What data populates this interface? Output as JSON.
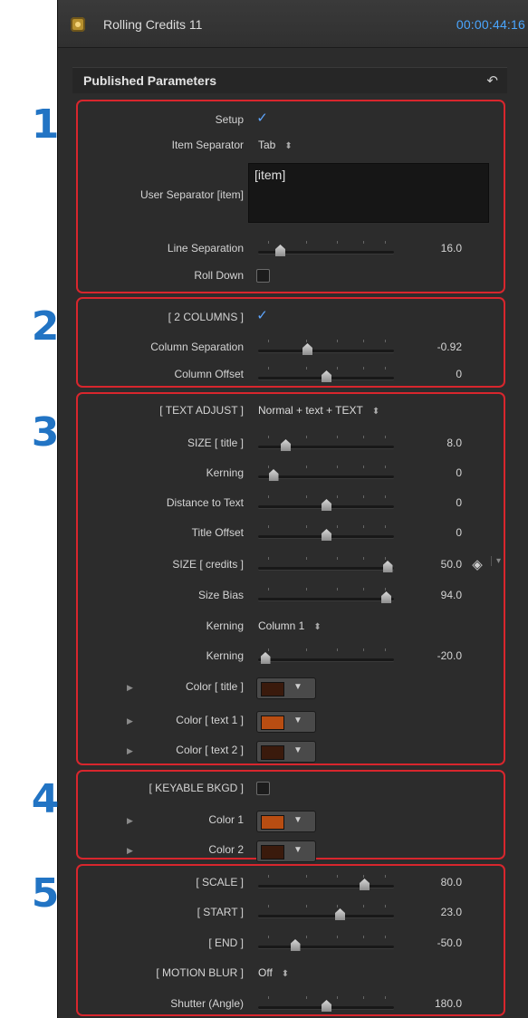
{
  "window": {
    "title": "Rolling Credits 11",
    "timecode": "00:00:44:16"
  },
  "panel": {
    "title": "Published Parameters"
  },
  "groups": [
    {
      "number": "1",
      "rows": [
        {
          "kind": "checkbox",
          "label": "Setup",
          "checked": true
        },
        {
          "kind": "popup",
          "label": "Item Separator",
          "value": "Tab"
        },
        {
          "kind": "textarea",
          "label": "User Separator [item]",
          "value": "[item]"
        },
        {
          "kind": "slider",
          "label": "Line Separation",
          "value": "16.0",
          "level": 0.16
        },
        {
          "kind": "checkbox",
          "label": "Roll Down",
          "checked": false
        }
      ]
    },
    {
      "number": "2",
      "rows": [
        {
          "kind": "checkbox",
          "label": "[  2  COLUMNS  ]",
          "checked": true
        },
        {
          "kind": "slider",
          "label": "Column Separation",
          "value": "-0.92",
          "level": 0.36
        },
        {
          "kind": "slider",
          "label": "Column Offset",
          "value": "0",
          "level": 0.5
        }
      ]
    },
    {
      "number": "3",
      "rows": [
        {
          "kind": "popup",
          "label": "[  TEXT ADJUST  ]",
          "value": "Normal + text + TEXT"
        },
        {
          "kind": "slider",
          "label": "SIZE  [ title ]",
          "value": "8.0",
          "level": 0.2
        },
        {
          "kind": "slider",
          "label": "Kerning",
          "value": "0",
          "level": 0.11
        },
        {
          "kind": "slider",
          "label": "Distance to Text",
          "value": "0",
          "level": 0.5
        },
        {
          "kind": "slider",
          "label": "Title Offset",
          "value": "0",
          "level": 0.5
        },
        {
          "kind": "slider",
          "label": "SIZE  [ credits ]",
          "value": "50.0",
          "level": 0.95
        },
        {
          "kind": "slider",
          "label": "Size Bias",
          "value": "94.0",
          "level": 0.94
        },
        {
          "kind": "popup",
          "label": "Kerning",
          "value": "Column 1"
        },
        {
          "kind": "slider",
          "label": "Kerning",
          "value": "-20.0",
          "level": 0.05
        },
        {
          "kind": "color",
          "label": "Color [ title ]",
          "color": "#3a1a0c"
        },
        {
          "kind": "color",
          "label": "Color [ text 1 ]",
          "color": "#b84d12"
        },
        {
          "kind": "color",
          "label": "Color [ text 2 ]",
          "color": "#3a1a0c"
        }
      ]
    },
    {
      "number": "4",
      "rows": [
        {
          "kind": "checkbox",
          "label": "[  KEYABLE BKGD  ]",
          "checked": false
        },
        {
          "kind": "color",
          "label": "Color 1",
          "color": "#b84d12"
        },
        {
          "kind": "color",
          "label": "Color 2",
          "color": "#3a1a0c"
        }
      ]
    },
    {
      "number": "5",
      "rows": [
        {
          "kind": "slider",
          "label": "[  SCALE  ]",
          "value": "80.0",
          "level": 0.78
        },
        {
          "kind": "slider",
          "label": "[  START  ]",
          "value": "23.0",
          "level": 0.6
        },
        {
          "kind": "slider",
          "label": "[    END    ]",
          "value": "-50.0",
          "level": 0.27
        },
        {
          "kind": "popup",
          "label": "[  MOTION BLUR  ]",
          "value": "Off"
        },
        {
          "kind": "slider",
          "label": "Shutter (Angle)",
          "value": "180.0",
          "level": 0.5
        }
      ]
    }
  ],
  "colors": {
    "outline": "#d8262d",
    "number": "#2274c4",
    "timecode": "#4aa6ff",
    "check": "#5ea6ff"
  },
  "icons": {
    "app": "motion-project-icon",
    "reset": "reset-arrow-icon",
    "keyframe": "keyframe-diamond-icon"
  }
}
